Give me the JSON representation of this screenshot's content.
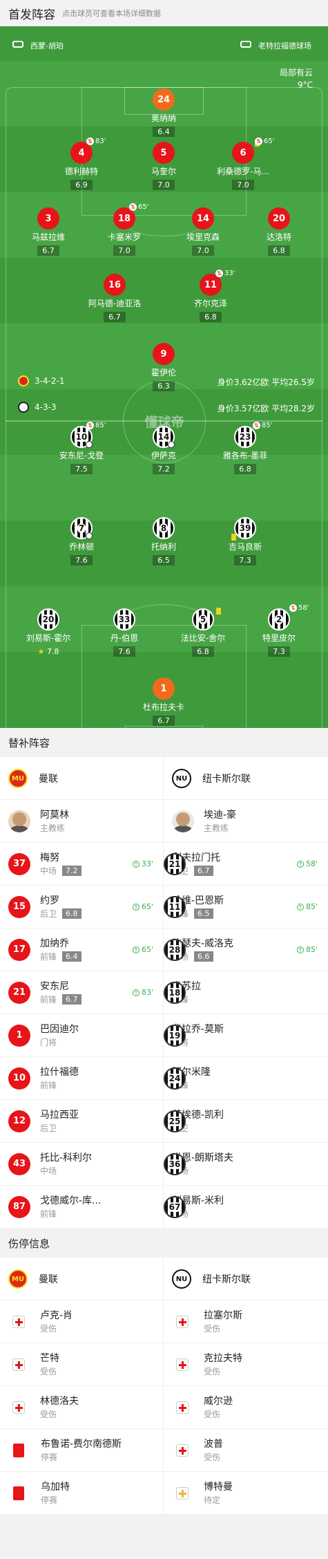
{
  "lineup": {
    "title": "首发阵容",
    "subtitle": "点击球员可查看本场详细数据"
  },
  "match": {
    "referee": "西蒙-胡珀",
    "stadium": "老特拉福德球场",
    "weather": "局部有云",
    "temperature": "9°C",
    "watermark": "懂球帝"
  },
  "home": {
    "formation": "3-4-2-1",
    "value": "身价3.62亿欧",
    "avg_age": "平均26.5岁",
    "players": [
      {
        "num": "24",
        "name": "奥纳纳",
        "rating": "6.4"
      },
      {
        "num": "4",
        "name": "德利赫特",
        "rating": "6.9",
        "event": "83'"
      },
      {
        "num": "5",
        "name": "马奎尔",
        "rating": "7.0"
      },
      {
        "num": "6",
        "name": "利桑德罗-马...",
        "rating": "7.0",
        "event": "65'"
      },
      {
        "num": "3",
        "name": "马兹拉维",
        "rating": "6.7"
      },
      {
        "num": "18",
        "name": "卡塞米罗",
        "rating": "7.0",
        "event": "65'"
      },
      {
        "num": "14",
        "name": "埃里克森",
        "rating": "7.0"
      },
      {
        "num": "20",
        "name": "达洛特",
        "rating": "6.8"
      },
      {
        "num": "16",
        "name": "阿马德-迪亚洛",
        "rating": "6.7"
      },
      {
        "num": "11",
        "name": "齐尔克泽",
        "rating": "6.8",
        "event": "33'"
      },
      {
        "num": "9",
        "name": "霍伊伦",
        "rating": "6.3"
      }
    ]
  },
  "away": {
    "formation": "4-3-3",
    "value": "身价3.57亿欧",
    "avg_age": "平均28.2岁",
    "players": [
      {
        "num": "10",
        "name": "安东尼-戈登",
        "rating": "7.5",
        "event": "85'"
      },
      {
        "num": "14",
        "name": "伊萨克",
        "rating": "7.2"
      },
      {
        "num": "23",
        "name": "雅各布-墨菲",
        "rating": "6.8",
        "event": "85'"
      },
      {
        "num": "7",
        "name": "乔林顿",
        "rating": "7.6"
      },
      {
        "num": "8",
        "name": "托纳利",
        "rating": "6.5"
      },
      {
        "num": "39",
        "name": "吉马良斯",
        "rating": "7.3"
      },
      {
        "num": "20",
        "name": "刘易斯-霍尔",
        "rating": "7.8"
      },
      {
        "num": "33",
        "name": "丹-伯恩",
        "rating": "7.6"
      },
      {
        "num": "5",
        "name": "法比安-舍尔",
        "rating": "6.8"
      },
      {
        "num": "2",
        "name": "特里皮尔",
        "rating": "7.3",
        "event": "58'"
      },
      {
        "num": "1",
        "name": "杜布拉夫卡",
        "rating": "6.7"
      }
    ]
  },
  "subs": {
    "title": "替补阵容",
    "home_team": "曼联",
    "away_team": "纽卡斯尔联",
    "home_coach": {
      "name": "阿莫林",
      "role": "主教练"
    },
    "away_coach": {
      "name": "埃迪-豪",
      "role": "主教练"
    },
    "home": [
      {
        "num": "37",
        "name": "梅努",
        "pos": "中场",
        "rating": "7.2",
        "in": "33'"
      },
      {
        "num": "15",
        "name": "约罗",
        "pos": "后卫",
        "rating": "6.8",
        "in": "65'"
      },
      {
        "num": "17",
        "name": "加纳乔",
        "pos": "前锋",
        "rating": "6.4",
        "in": "65'"
      },
      {
        "num": "21",
        "name": "安东尼",
        "pos": "前锋",
        "rating": "6.7",
        "in": "83'"
      },
      {
        "num": "1",
        "name": "巴因迪尔",
        "pos": "门将"
      },
      {
        "num": "10",
        "name": "拉什福德",
        "pos": "前锋"
      },
      {
        "num": "12",
        "name": "马拉西亚",
        "pos": "后卫"
      },
      {
        "num": "43",
        "name": "托比-科利尔",
        "pos": "中场"
      },
      {
        "num": "87",
        "name": "戈德威尔-库...",
        "pos": "前锋"
      }
    ],
    "away": [
      {
        "num": "21",
        "name": "利夫拉门托",
        "pos": "后卫",
        "rating": "6.7",
        "in": "58'"
      },
      {
        "num": "11",
        "name": "哈维-巴恩斯",
        "pos": "前锋",
        "rating": "6.5",
        "in": "85'"
      },
      {
        "num": "28",
        "name": "约瑟夫-威洛克",
        "pos": "中场",
        "rating": "6.6",
        "in": "85'"
      },
      {
        "num": "18",
        "name": "奥苏拉",
        "pos": "前锋"
      },
      {
        "num": "19",
        "name": "弗拉乔-莫斯",
        "pos": "门将"
      },
      {
        "num": "24",
        "name": "阿尔米隆",
        "pos": "前锋"
      },
      {
        "num": "25",
        "name": "劳埃德-凯利",
        "pos": "后卫"
      },
      {
        "num": "36",
        "name": "肖恩-朗斯塔夫",
        "pos": "中场"
      },
      {
        "num": "67",
        "name": "刘易斯-米利",
        "pos": "中场"
      }
    ]
  },
  "injuries": {
    "title": "伤停信息",
    "home_team": "曼联",
    "away_team": "纽卡斯尔联",
    "home": [
      {
        "name": "卢克-肖",
        "status": "受伤",
        "type": "injury"
      },
      {
        "name": "芒特",
        "status": "受伤",
        "type": "injury"
      },
      {
        "name": "林德洛夫",
        "status": "受伤",
        "type": "injury"
      },
      {
        "name": "布鲁诺-费尔南德斯",
        "status": "停赛",
        "type": "suspension"
      },
      {
        "name": "乌加特",
        "status": "停赛",
        "type": "suspension"
      }
    ],
    "away": [
      {
        "name": "拉塞尔斯",
        "status": "受伤",
        "type": "injury"
      },
      {
        "name": "克拉夫特",
        "status": "受伤",
        "type": "injury"
      },
      {
        "name": "威尔逊",
        "status": "受伤",
        "type": "injury"
      },
      {
        "name": "波普",
        "status": "受伤",
        "type": "injury"
      },
      {
        "name": "博特曼",
        "status": "待定",
        "type": "doubtful"
      }
    ]
  },
  "colors": {
    "pitch": "#3f9a3b",
    "home_circle": "#e7141a",
    "away_stripes": "#111111",
    "goalkeeper": "#f26b1d",
    "sub_in": "#3ab04a"
  }
}
